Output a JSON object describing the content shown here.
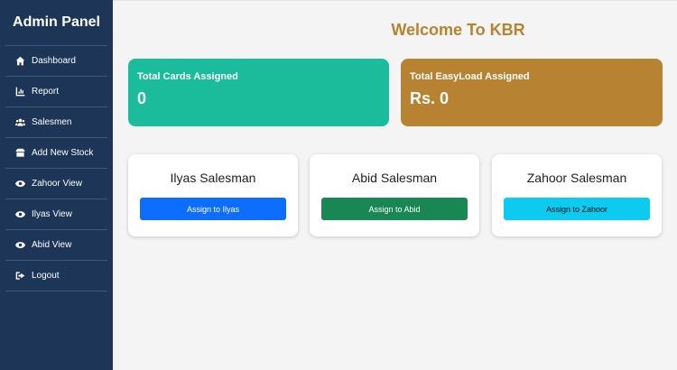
{
  "sidebar": {
    "title": "Admin Panel",
    "items": [
      {
        "label": "Dashboard",
        "icon": "home-icon"
      },
      {
        "label": "Report",
        "icon": "chart-icon"
      },
      {
        "label": "Salesmen",
        "icon": "users-icon"
      },
      {
        "label": "Add New Stock",
        "icon": "box-icon"
      },
      {
        "label": "Zahoor View",
        "icon": "eye-icon"
      },
      {
        "label": "Ilyas View",
        "icon": "eye-icon"
      },
      {
        "label": "Abid View",
        "icon": "eye-icon"
      },
      {
        "label": "Logout",
        "icon": "logout-icon"
      }
    ]
  },
  "main": {
    "title": "Welcome To KBR",
    "stats": [
      {
        "label": "Total Cards Assigned",
        "value": "0",
        "color": "#1abc9c"
      },
      {
        "label": "Total EasyLoad Assigned",
        "value": "Rs. 0",
        "color": "#b78332"
      }
    ],
    "salesmen": [
      {
        "name": "Ilyas Salesman",
        "button": "Assign to Ilyas",
        "color": "#0d6efd"
      },
      {
        "name": "Abid Salesman",
        "button": "Assign to Abid",
        "color": "#198754"
      },
      {
        "name": "Zahoor Salesman",
        "button": "Assign to Zahoor",
        "color": "#0dcaf0"
      }
    ]
  }
}
